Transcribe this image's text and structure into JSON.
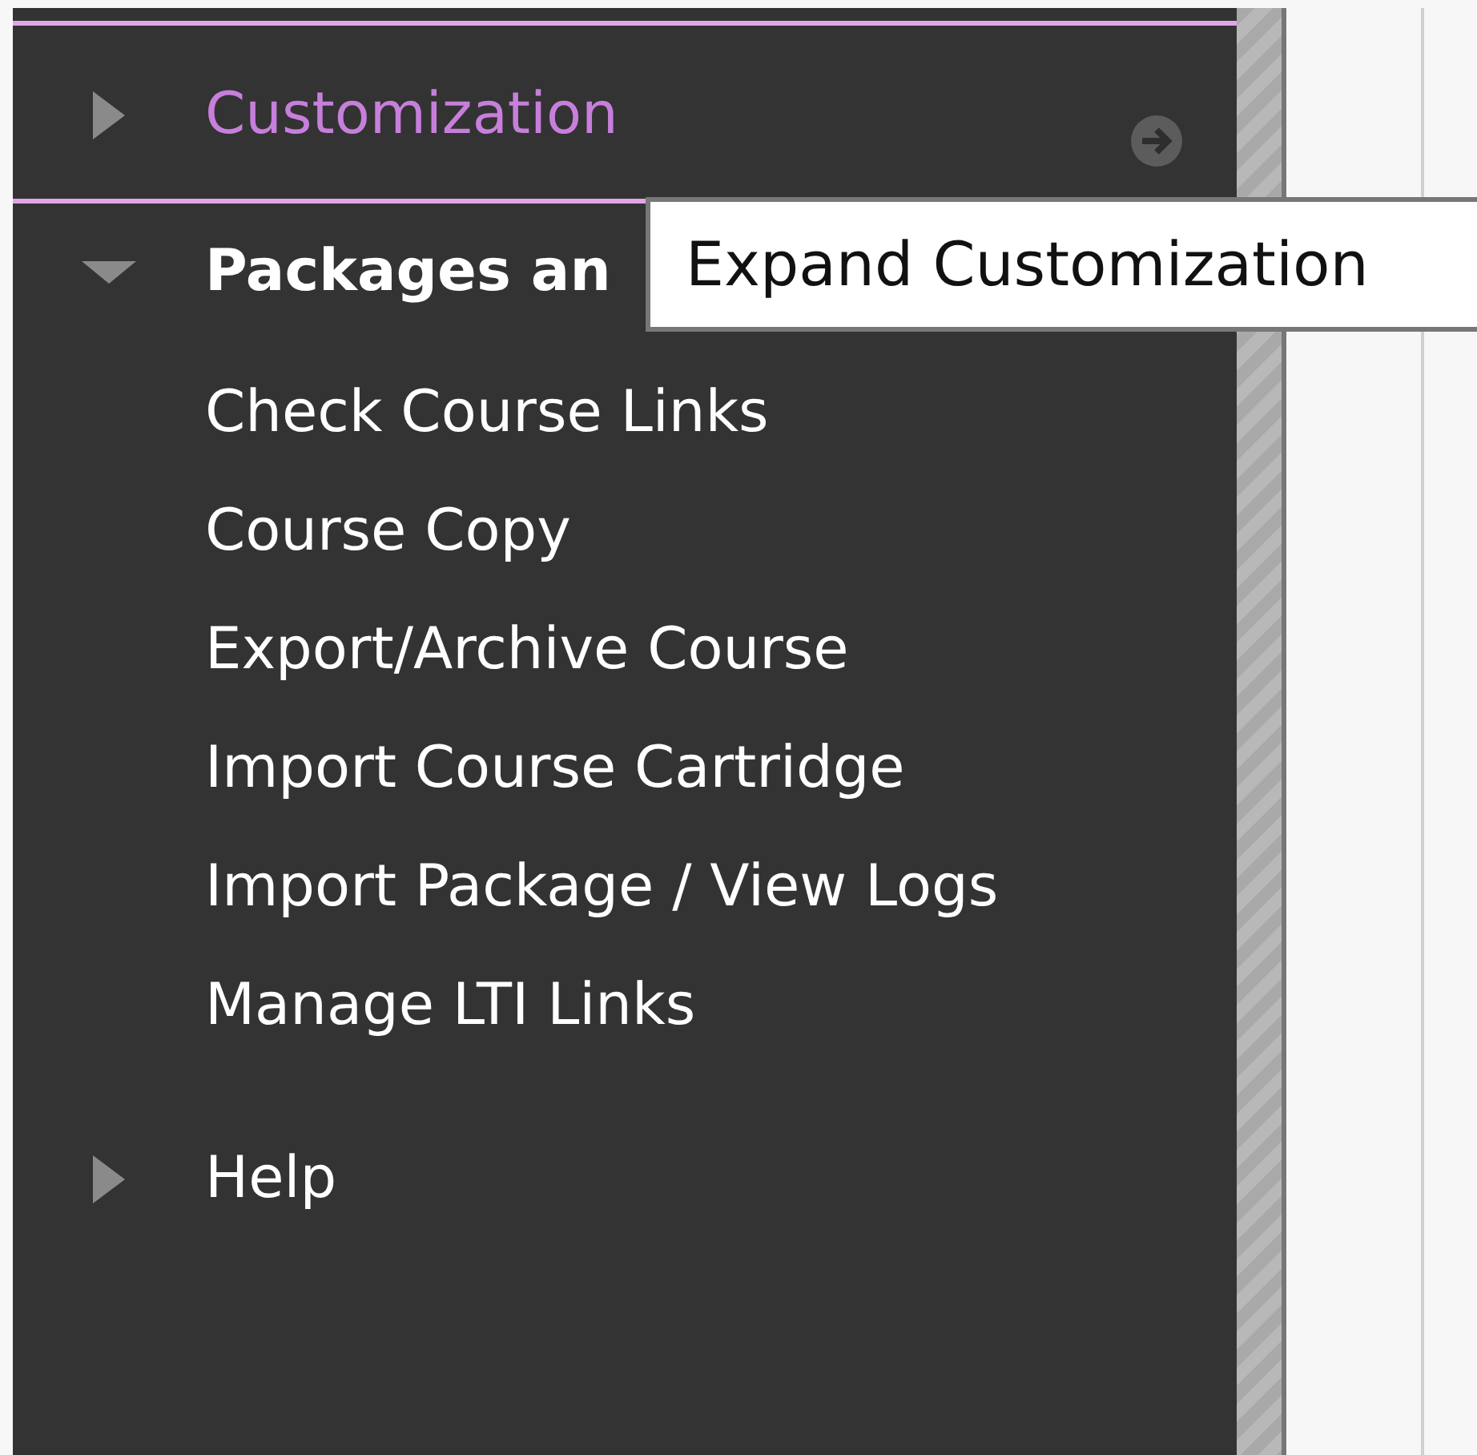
{
  "sidebar": {
    "sections": [
      {
        "label": "Customization",
        "selected": true,
        "expanded": false
      },
      {
        "label": "Packages an",
        "selected": false,
        "expanded": true,
        "items": [
          "Check Course Links",
          "Course Copy",
          "Export/Archive Course",
          "Import Course Cartridge",
          "Import Package / View Logs",
          "Manage LTI Links"
        ]
      },
      {
        "label": "Help",
        "selected": false,
        "expanded": false
      }
    ]
  },
  "tooltip": {
    "text": "Expand Customization"
  }
}
